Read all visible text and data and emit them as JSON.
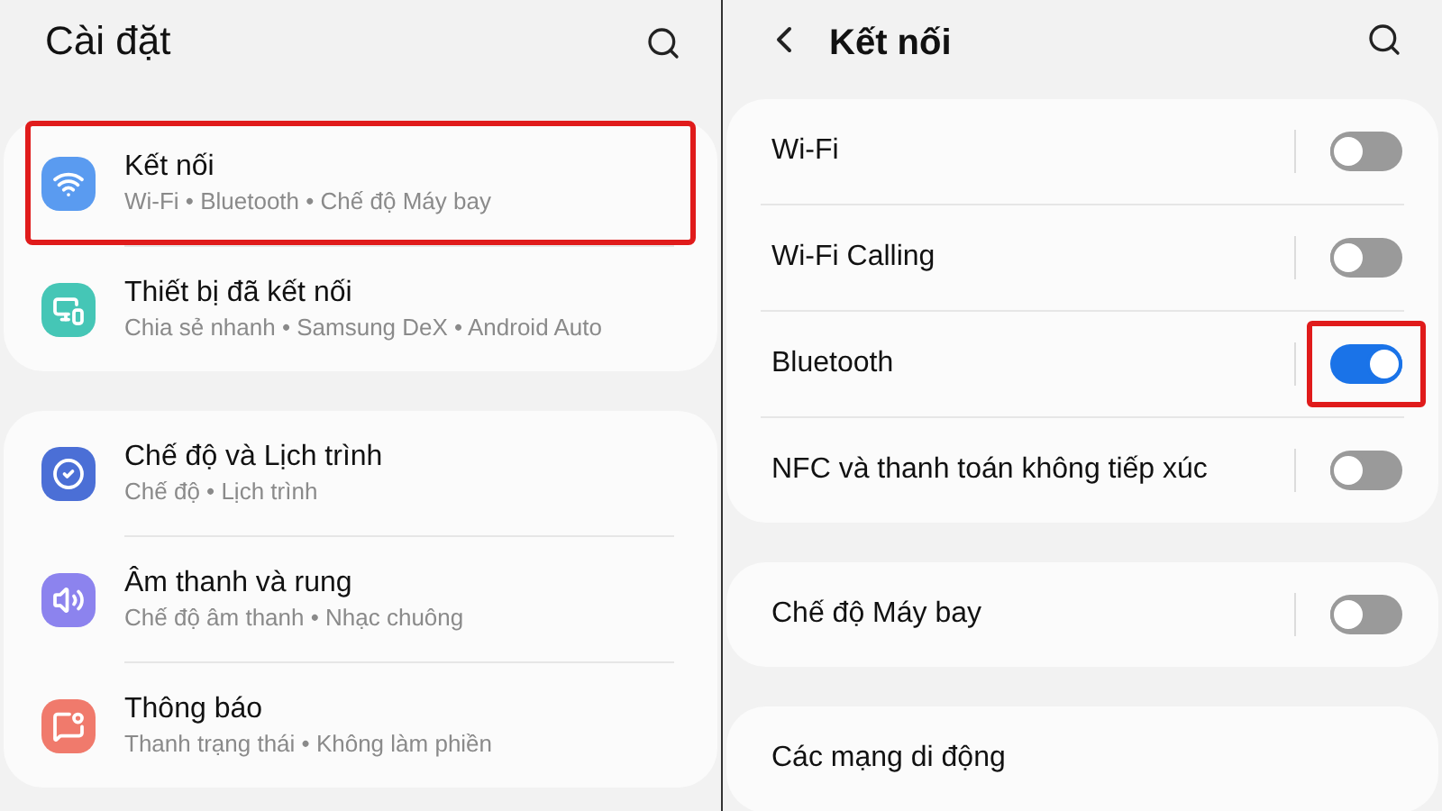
{
  "settings_screen": {
    "title": "Cài đặt",
    "sections": [
      {
        "items": [
          {
            "title": "Kết nối",
            "subtitle": "Wi-Fi • Bluetooth • Chế độ Máy bay",
            "color": "#5a9bf0",
            "highlighted": true
          },
          {
            "title": "Thiết bị đã kết nối",
            "subtitle": "Chia sẻ nhanh • Samsung DeX • Android Auto",
            "color": "#45c6b6",
            "highlighted": false
          }
        ]
      },
      {
        "items": [
          {
            "title": "Chế độ và Lịch trình",
            "subtitle": "Chế độ • Lịch trình",
            "color": "#4b6fd6",
            "highlighted": false
          },
          {
            "title": "Âm thanh và rung",
            "subtitle": "Chế độ âm thanh • Nhạc chuông",
            "color": "#8c83ee",
            "highlighted": false
          },
          {
            "title": "Thông báo",
            "subtitle": "Thanh trạng thái • Không làm phiền",
            "color": "#f07a6c",
            "highlighted": false
          }
        ]
      }
    ]
  },
  "connections_screen": {
    "title": "Kết nối",
    "sections": [
      {
        "rows": [
          {
            "label": "Wi-Fi",
            "kind": "toggle",
            "on": false,
            "highlighted": false
          },
          {
            "label": "Wi-Fi Calling",
            "kind": "toggle",
            "on": false,
            "highlighted": false
          },
          {
            "label": "Bluetooth",
            "kind": "toggle",
            "on": true,
            "highlighted": true
          },
          {
            "label": "NFC và thanh toán không tiếp xúc",
            "kind": "toggle",
            "on": false,
            "highlighted": false
          }
        ]
      },
      {
        "rows": [
          {
            "label": "Chế độ Máy bay",
            "kind": "toggle",
            "on": false,
            "highlighted": false
          }
        ]
      },
      {
        "rows": [
          {
            "label": "Các mạng di động",
            "kind": "link"
          }
        ]
      }
    ]
  }
}
